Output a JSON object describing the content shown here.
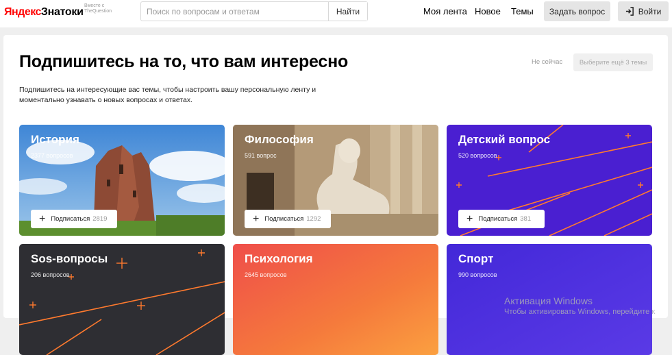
{
  "header": {
    "logo_ya": "Яндекс",
    "logo_rest": " Знатоки",
    "logo_sub": "Вместе с TheQuestion",
    "search_placeholder": "Поиск по вопросам и ответам",
    "search_button": "Найти",
    "nav": [
      "Моя лента",
      "Новое",
      "Темы"
    ],
    "ask_button": "Задать вопрос",
    "login_button": "Войти"
  },
  "main": {
    "title": "Подпишитесь на то, что вам интересно",
    "subtitle": "Подпишитесь на интересующие вас темы, чтобы настроить вашу персональную ленту и моментально узнавать о новых вопросах и ответах.",
    "not_now": "Не сейчас",
    "choose_button": "Выберите ещё 3 темы"
  },
  "topics": [
    {
      "title": "История",
      "count": "2377 вопросов",
      "subscribe_label": "Подписаться",
      "subscribers": "2819"
    },
    {
      "title": "Философия",
      "count": "591 вопрос",
      "subscribe_label": "Подписаться",
      "subscribers": "1292"
    },
    {
      "title": "Детский вопрос",
      "count": "520 вопросов",
      "subscribe_label": "Подписаться",
      "subscribers": "381"
    },
    {
      "title": "Sos-вопросы",
      "count": "206 вопросов"
    },
    {
      "title": "Психология",
      "count": "2645 вопросов"
    },
    {
      "title": "Спорт",
      "count": "990 вопросов"
    }
  ],
  "watermark": {
    "line1": "Активация Windows",
    "line2": "Чтобы активировать Windows, перейдите к"
  },
  "colors": {
    "brand_red": "#ff0000",
    "card_purple": "#4a1fd1",
    "card_dark": "#2e2e33",
    "card_orange": "#f26a3c",
    "accent_orange": "#ff7a2e"
  }
}
